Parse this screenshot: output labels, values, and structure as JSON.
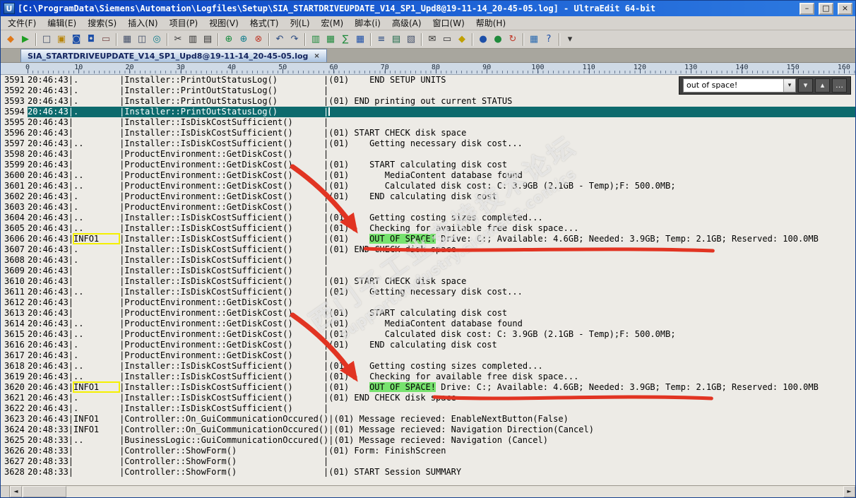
{
  "window": {
    "icon_glyph": "U",
    "title": "[C:\\ProgramData\\Siemens\\Automation\\Logfiles\\Setup\\SIA_STARTDRIVEUPDATE_V14_SP1_Upd8@19-11-14_20-45-05.log] - UltraEdit 64-bit",
    "controls": {
      "minimize": "–",
      "maximize": "□",
      "close": "×"
    }
  },
  "menu": {
    "items": [
      {
        "key": "file",
        "label": "文件(F)"
      },
      {
        "key": "edit",
        "label": "编辑(E)"
      },
      {
        "key": "search",
        "label": "搜索(S)"
      },
      {
        "key": "insert",
        "label": "插入(N)"
      },
      {
        "key": "project",
        "label": "项目(P)"
      },
      {
        "key": "view",
        "label": "视图(V)"
      },
      {
        "key": "format",
        "label": "格式(T)"
      },
      {
        "key": "column",
        "label": "列(L)"
      },
      {
        "key": "macro",
        "label": "宏(M)"
      },
      {
        "key": "scripting",
        "label": "脚本(i)"
      },
      {
        "key": "advanced",
        "label": "高级(A)"
      },
      {
        "key": "window",
        "label": "窗口(W)"
      },
      {
        "key": "help",
        "label": "帮助(H)"
      }
    ]
  },
  "toolbar": {
    "icons": [
      {
        "name": "ue-logo",
        "glyph": "◆",
        "color": "#e07818"
      },
      {
        "name": "play-macro",
        "glyph": "▶",
        "color": "#1f9e23"
      },
      {
        "sep": true
      },
      {
        "name": "new-file",
        "glyph": "□",
        "color": "#44506a"
      },
      {
        "name": "open-file",
        "glyph": "▣",
        "color": "#b8860b"
      },
      {
        "name": "save-file",
        "glyph": "◙",
        "color": "#1d4fa8"
      },
      {
        "name": "save-all",
        "glyph": "◘",
        "color": "#1d4fa8"
      },
      {
        "name": "close-file",
        "glyph": "▭",
        "color": "#7a4a4a"
      },
      {
        "sep": true
      },
      {
        "name": "print",
        "glyph": "▦",
        "color": "#44506a"
      },
      {
        "name": "print-preview",
        "glyph": "◫",
        "color": "#44506a"
      },
      {
        "name": "find",
        "glyph": "◎",
        "color": "#0e7c8c"
      },
      {
        "sep": true
      },
      {
        "name": "cut",
        "glyph": "✂",
        "color": "#333333"
      },
      {
        "name": "copy",
        "glyph": "▥",
        "color": "#333333"
      },
      {
        "name": "paste",
        "glyph": "▤",
        "color": "#333333"
      },
      {
        "sep": true
      },
      {
        "name": "compare-files",
        "glyph": "⊕",
        "color": "#148a3c"
      },
      {
        "name": "compare-folders",
        "glyph": "⊕",
        "color": "#0e7c8c"
      },
      {
        "name": "merge-changes",
        "glyph": "⊗",
        "color": "#c03a2a"
      },
      {
        "sep": true
      },
      {
        "name": "undo",
        "glyph": "↶",
        "color": "#2a4a80"
      },
      {
        "name": "redo",
        "glyph": "↷",
        "color": "#2a4a80"
      },
      {
        "sep": true
      },
      {
        "name": "column-mode",
        "glyph": "▥",
        "color": "#1f8a3c"
      },
      {
        "name": "column-insert",
        "glyph": "▦",
        "color": "#1f8a3c"
      },
      {
        "name": "column-sum",
        "glyph": "∑",
        "color": "#1f8a3c"
      },
      {
        "name": "table-view",
        "glyph": "▦",
        "color": "#1d4fa8"
      },
      {
        "sep": true
      },
      {
        "name": "function-list",
        "glyph": "≡",
        "color": "#2a4a80"
      },
      {
        "name": "tag-list",
        "glyph": "▤",
        "color": "#1f6a4a"
      },
      {
        "name": "template-list",
        "glyph": "▧",
        "color": "#44506a"
      },
      {
        "sep": true
      },
      {
        "name": "send-mail",
        "glyph": "✉",
        "color": "#333333"
      },
      {
        "name": "clipboard-history",
        "glyph": "▭",
        "color": "#333333"
      },
      {
        "name": "bookmark",
        "glyph": "◆",
        "color": "#c0a000"
      },
      {
        "sep": true
      },
      {
        "name": "browser-view",
        "glyph": "●",
        "color": "#1d4fa8"
      },
      {
        "name": "ftp-open",
        "glyph": "●",
        "color": "#1f8a3c"
      },
      {
        "name": "refresh",
        "glyph": "↻",
        "color": "#c03a2a"
      },
      {
        "sep": true
      },
      {
        "name": "grid-settings",
        "glyph": "▦",
        "color": "#2a6ab0"
      },
      {
        "name": "help",
        "glyph": "?",
        "color": "#1d4fa8"
      },
      {
        "sep": true
      },
      {
        "name": "more-tools",
        "glyph": "▾",
        "color": "#333333"
      }
    ]
  },
  "tab": {
    "label": "SIA_STARTDRIVEUPDATE_V14_SP1_Upd8@19-11-14_20-45-05.log",
    "close_glyph": "×"
  },
  "ruler": {
    "marks": [
      0,
      10,
      20,
      30,
      40,
      50,
      60,
      70,
      80,
      90,
      100,
      110,
      120,
      130,
      140,
      150,
      160
    ]
  },
  "search": {
    "value": "out of space!",
    "combo_arrow": "▾",
    "buttons": [
      {
        "name": "find-next",
        "glyph": "▾"
      },
      {
        "name": "find-prev",
        "glyph": "▴"
      },
      {
        "name": "find-options",
        "glyph": "…"
      }
    ]
  },
  "watermark": {
    "line1": "西门子工业支持技术论坛",
    "line2": "support.industry.siemens.com/cs"
  },
  "colors": {
    "selected_line": "#0d6a6d",
    "found_highlight": "#77e26e",
    "info_box_outline": "#f5f000",
    "annotation_red": "#e13422"
  },
  "scrollbar": {
    "left_arrow": "◄",
    "right_arrow": "►"
  },
  "editor": {
    "lines": [
      {
        "num": 3591,
        "time": "20:46:43",
        "status": ".",
        "func": "Installer::PrintOutStatusLog()",
        "msg": "(01)    END SETUP UNITS"
      },
      {
        "num": 3592,
        "time": "20:46:43",
        "status": ".",
        "func": "Installer::PrintOutStatusLog()",
        "msg": ""
      },
      {
        "num": 3593,
        "time": "20:46:43",
        "status": ".",
        "func": "Installer::PrintOutStatusLog()",
        "msg": "(01) END printing out current STATUS"
      },
      {
        "num": 3594,
        "time": "20:46:43",
        "status": ".",
        "func": "Installer::PrintOutStatusLog()",
        "msg": "",
        "sel": true,
        "caret": true
      },
      {
        "num": 3595,
        "time": "20:46:43",
        "status": "",
        "func": "Installer::IsDiskCostSufficient()",
        "msg": ""
      },
      {
        "num": 3596,
        "time": "20:46:43",
        "status": "",
        "func": "Installer::IsDiskCostSufficient()",
        "msg": "(01) START CHECK disk space"
      },
      {
        "num": 3597,
        "time": "20:46:43",
        "status": "..",
        "func": "Installer::IsDiskCostSufficient()",
        "msg": "(01)    Getting necessary disk cost..."
      },
      {
        "num": 3598,
        "time": "20:46:43",
        "status": "",
        "func": "ProductEnvironment::GetDiskCost()",
        "msg": ""
      },
      {
        "num": 3599,
        "time": "20:46:43",
        "status": "",
        "func": "ProductEnvironment::GetDiskCost()",
        "msg": "(01)    START calculating disk cost"
      },
      {
        "num": 3600,
        "time": "20:46:43",
        "status": "..",
        "func": "ProductEnvironment::GetDiskCost()",
        "msg": "(01)       MediaContent database found"
      },
      {
        "num": 3601,
        "time": "20:46:43",
        "status": "..",
        "func": "ProductEnvironment::GetDiskCost()",
        "msg": "(01)       Calculated disk cost: C: 3.9GB (2.1GB - Temp);F: 500.0MB;"
      },
      {
        "num": 3602,
        "time": "20:46:43",
        "status": ".",
        "func": "ProductEnvironment::GetDiskCost()",
        "msg": "(01)    END calculating disk cost"
      },
      {
        "num": 3603,
        "time": "20:46:43",
        "status": ".",
        "func": "ProductEnvironment::GetDiskCost()",
        "msg": ""
      },
      {
        "num": 3604,
        "time": "20:46:43",
        "status": "..",
        "func": "Installer::IsDiskCostSufficient()",
        "msg": "(01)    Getting costing sizes completed..."
      },
      {
        "num": 3605,
        "time": "20:46:43",
        "status": "..",
        "func": "Installer::IsDiskCostSufficient()",
        "msg": "(01)    Checking for available free disk space..."
      },
      {
        "num": 3606,
        "time": "20:46:43",
        "status": "INFO1",
        "func": "Installer::IsDiskCostSufficient()",
        "msg": "(01)    OUT OF SPACE! Drive: C:; Available: 4.6GB; Needed: 3.9GB; Temp: 2.1GB; Reserved: 100.0MB",
        "box": true,
        "hl": "OUT OF SPACE!"
      },
      {
        "num": 3607,
        "time": "20:46:43",
        "status": ".",
        "func": "Installer::IsDiskCostSufficient()",
        "msg": "(01) END CHECK disk space"
      },
      {
        "num": 3608,
        "time": "20:46:43",
        "status": ".",
        "func": "Installer::IsDiskCostSufficient()",
        "msg": ""
      },
      {
        "num": 3609,
        "time": "20:46:43",
        "status": "",
        "func": "Installer::IsDiskCostSufficient()",
        "msg": ""
      },
      {
        "num": 3610,
        "time": "20:46:43",
        "status": "",
        "func": "Installer::IsDiskCostSufficient()",
        "msg": "(01) START CHECK disk space"
      },
      {
        "num": 3611,
        "time": "20:46:43",
        "status": "..",
        "func": "Installer::IsDiskCostSufficient()",
        "msg": "(01)    Getting necessary disk cost..."
      },
      {
        "num": 3612,
        "time": "20:46:43",
        "status": "",
        "func": "ProductEnvironment::GetDiskCost()",
        "msg": ""
      },
      {
        "num": 3613,
        "time": "20:46:43",
        "status": "",
        "func": "ProductEnvironment::GetDiskCost()",
        "msg": "(01)    START calculating disk cost"
      },
      {
        "num": 3614,
        "time": "20:46:43",
        "status": "..",
        "func": "ProductEnvironment::GetDiskCost()",
        "msg": "(01)       MediaContent database found"
      },
      {
        "num": 3615,
        "time": "20:46:43",
        "status": "..",
        "func": "ProductEnvironment::GetDiskCost()",
        "msg": "(01)       Calculated disk cost: C: 3.9GB (2.1GB - Temp);F: 500.0MB;"
      },
      {
        "num": 3616,
        "time": "20:46:43",
        "status": ".",
        "func": "ProductEnvironment::GetDiskCost()",
        "msg": "(01)    END calculating disk cost"
      },
      {
        "num": 3617,
        "time": "20:46:43",
        "status": ".",
        "func": "ProductEnvironment::GetDiskCost()",
        "msg": ""
      },
      {
        "num": 3618,
        "time": "20:46:43",
        "status": "..",
        "func": "Installer::IsDiskCostSufficient()",
        "msg": "(01)    Getting costing sizes completed..."
      },
      {
        "num": 3619,
        "time": "20:46:43",
        "status": "..",
        "func": "Installer::IsDiskCostSufficient()",
        "msg": "(01)    Checking for available free disk space..."
      },
      {
        "num": 3620,
        "time": "20:46:43",
        "status": "INFO1",
        "func": "Installer::IsDiskCostSufficient()",
        "msg": "(01)    OUT OF SPACE! Drive: C:; Available: 4.6GB; Needed: 3.9GB; Temp: 2.1GB; Reserved: 100.0MB",
        "box": true,
        "hl": "OUT OF SPACE!"
      },
      {
        "num": 3621,
        "time": "20:46:43",
        "status": ".",
        "func": "Installer::IsDiskCostSufficient()",
        "msg": "(01) END CHECK disk space"
      },
      {
        "num": 3622,
        "time": "20:46:43",
        "status": ".",
        "func": "Installer::IsDiskCostSufficient()",
        "msg": ""
      },
      {
        "num": 3623,
        "time": "20:46:43",
        "status": "INFO1",
        "func": "Controller::On_GuiCommunicationOccured()",
        "msg": "(01) Message recieved: EnableNextButton(False)"
      },
      {
        "num": 3624,
        "time": "20:48:33",
        "status": "INFO1",
        "func": "Controller::On_GuiCommunicationOccured()",
        "msg": "(01) Message recieved: Navigation Direction(Cancel)"
      },
      {
        "num": 3625,
        "time": "20:48:33",
        "status": "..",
        "func": "BusinessLogic::GuiCommunicationOccured()",
        "msg": "(01) Message recieved: Navigation (Cancel)"
      },
      {
        "num": 3626,
        "time": "20:48:33",
        "status": "",
        "func": "Controller::ShowForm()",
        "msg": "(01) Form: FinishScreen"
      },
      {
        "num": 3627,
        "time": "20:48:33",
        "status": "",
        "func": "Controller::ShowForm()",
        "msg": ""
      },
      {
        "num": 3628,
        "time": "20:48:33",
        "status": "",
        "func": "Controller::ShowForm()",
        "msg": "(01) START Session SUMMARY"
      }
    ]
  }
}
